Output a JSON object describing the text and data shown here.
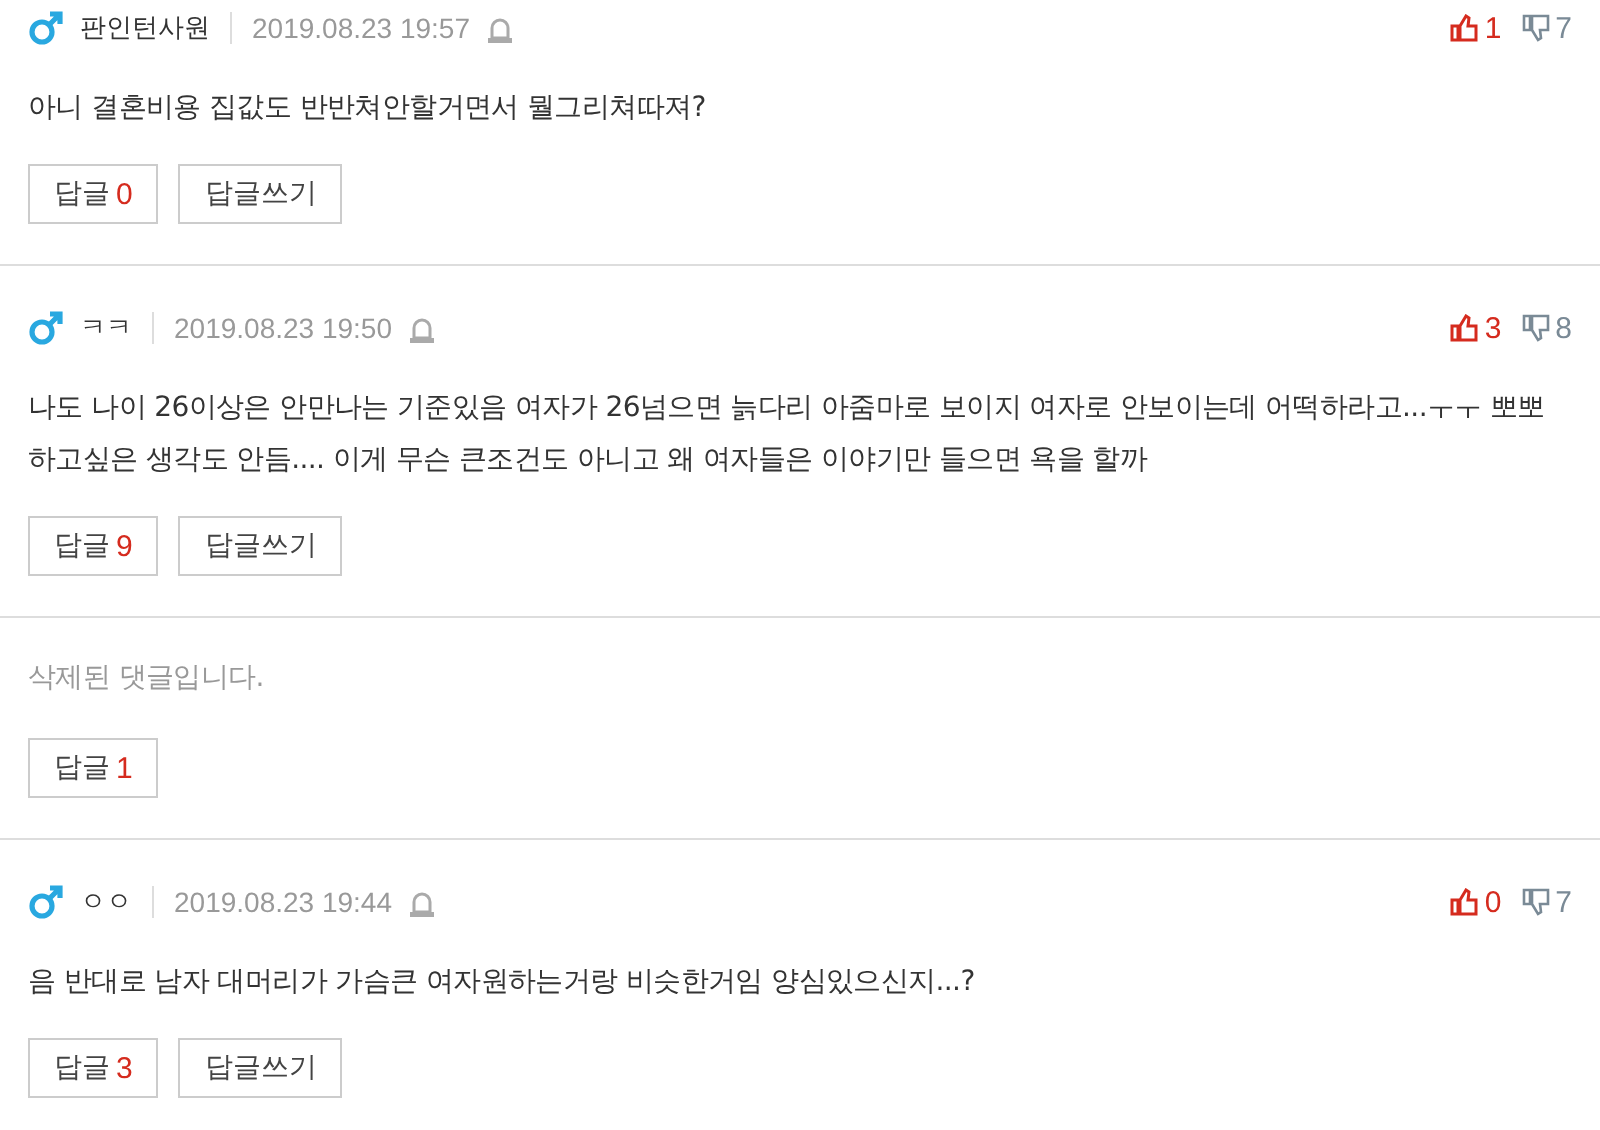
{
  "comments": [
    {
      "kind": "comment",
      "author": "판인턴사원",
      "date": "2019.08.23 19:57",
      "body": "아니 결혼비용 집값도 반반쳐안할거면서 뭘그리쳐따져?",
      "likes": "1",
      "dislikes": "7",
      "reply_label": "답글",
      "reply_count": "0",
      "write_label": "답글쓰기"
    },
    {
      "kind": "comment",
      "author": "ㅋㅋ",
      "date": "2019.08.23 19:50",
      "body": "나도 나이 26이상은 안만나는 기준있음 여자가 26넘으면 늙다리 아줌마로 보이지 여자로 안보이는데 어떡하라고...ㅜㅜ 뽀뽀하고싶은 생각도 안듬.... 이게 무슨 큰조건도 아니고 왜 여자들은 이야기만 들으면 욕을 할까",
      "likes": "3",
      "dislikes": "8",
      "reply_label": "답글",
      "reply_count": "9",
      "write_label": "답글쓰기"
    },
    {
      "kind": "deleted",
      "body": "삭제된 댓글입니다.",
      "reply_label": "답글",
      "reply_count": "1"
    },
    {
      "kind": "comment",
      "author": "ㅇㅇ",
      "date": "2019.08.23 19:44",
      "body": "음 반대로 남자 대머리가 가슴큰 여자원하는거랑 비슷한거임 양심있으신지...?",
      "likes": "0",
      "dislikes": "7",
      "reply_label": "답글",
      "reply_count": "3",
      "write_label": "답글쓰기"
    }
  ]
}
